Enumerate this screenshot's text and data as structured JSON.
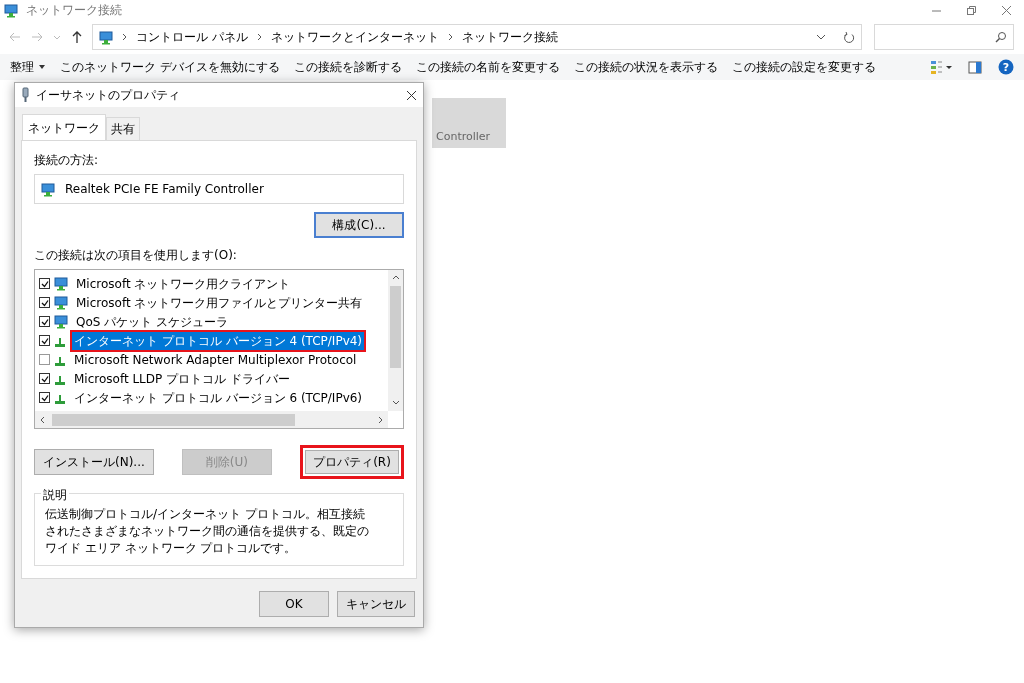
{
  "window": {
    "title": "ネットワーク接続"
  },
  "address_bar": {
    "path": [
      "コントロール パネル",
      "ネットワークとインターネット",
      "ネットワーク接続"
    ]
  },
  "toolbar": {
    "items": [
      {
        "label": "整理",
        "dropdown": true
      },
      {
        "label": "このネットワーク デバイスを無効にする",
        "dropdown": false
      },
      {
        "label": "この接続を診断する",
        "dropdown": false
      },
      {
        "label": "この接続の名前を変更する",
        "dropdown": false
      },
      {
        "label": "この接続の状況を表示する",
        "dropdown": false
      },
      {
        "label": "この接続の設定を変更する",
        "dropdown": false
      }
    ],
    "help_label": "?"
  },
  "background_tile": {
    "label": "Controller"
  },
  "dialog": {
    "title": "イーサネットのプロパティ",
    "tabs": [
      {
        "label": "ネットワーク",
        "selected": true
      },
      {
        "label": "共有",
        "selected": false
      }
    ],
    "connect_using_label": "接続の方法:",
    "adapter": "Realtek PCIe FE Family Controller",
    "configure_button": "構成(C)...",
    "items_label": "この接続は次の項目を使用します(O):",
    "items": [
      {
        "label": "Microsoft ネットワーク用クライアント",
        "kind": "client",
        "checked": true,
        "selected": false,
        "highlighted": false
      },
      {
        "label": "Microsoft ネットワーク用ファイルとプリンター共有",
        "kind": "client",
        "checked": true,
        "selected": false,
        "highlighted": false
      },
      {
        "label": "QoS パケット スケジューラ",
        "kind": "client",
        "checked": true,
        "selected": false,
        "highlighted": false
      },
      {
        "label": "インターネット プロトコル バージョン 4 (TCP/IPv4)",
        "kind": "protocol",
        "checked": true,
        "selected": true,
        "highlighted": true
      },
      {
        "label": "Microsoft Network Adapter Multiplexor Protocol",
        "kind": "protocol",
        "checked": false,
        "selected": false,
        "highlighted": false
      },
      {
        "label": "Microsoft LLDP プロトコル ドライバー",
        "kind": "protocol",
        "checked": true,
        "selected": false,
        "highlighted": false
      },
      {
        "label": "インターネット プロトコル バージョン 6 (TCP/IPv6)",
        "kind": "protocol",
        "checked": true,
        "selected": false,
        "highlighted": false
      }
    ],
    "buttons": [
      {
        "label": "インストール(N)...",
        "disabled": false,
        "highlighted": false
      },
      {
        "label": "削除(U)",
        "disabled": true,
        "highlighted": false
      },
      {
        "label": "プロパティ(R)",
        "disabled": false,
        "highlighted": true
      }
    ],
    "description": {
      "title": "説明",
      "text": "伝送制御プロトコル/インターネット プロトコル。相互接続されたさまざまなネットワーク間の通信を提供する、既定のワイド エリア ネットワーク プロトコルです。"
    },
    "footer_buttons": [
      "OK",
      "キャンセル"
    ]
  }
}
